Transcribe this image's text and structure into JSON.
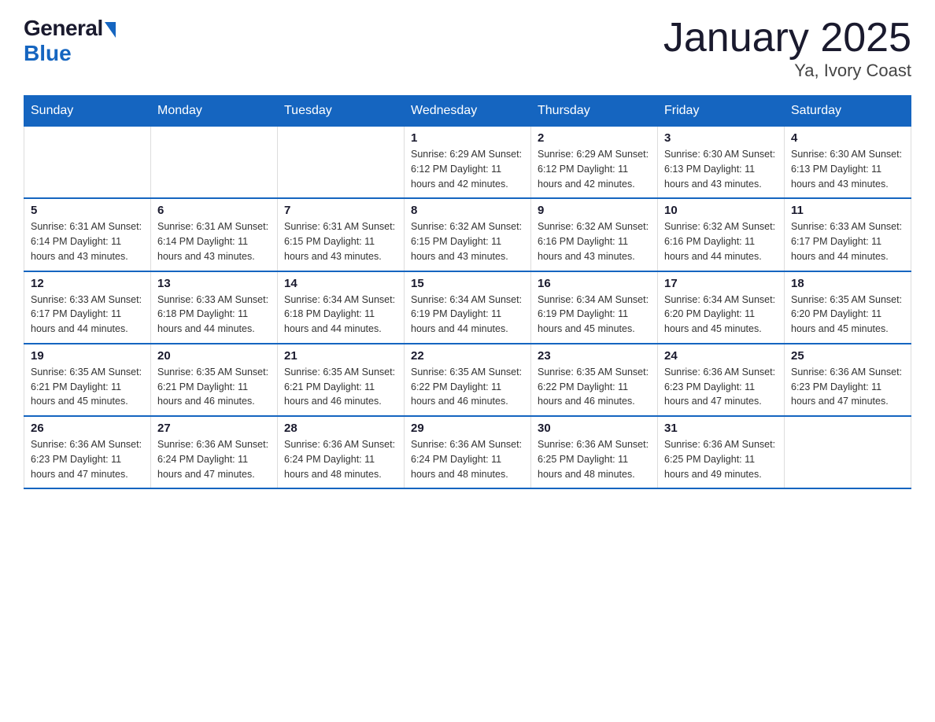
{
  "logo": {
    "general": "General",
    "blue": "Blue"
  },
  "title": "January 2025",
  "subtitle": "Ya, Ivory Coast",
  "days_of_week": [
    "Sunday",
    "Monday",
    "Tuesday",
    "Wednesday",
    "Thursday",
    "Friday",
    "Saturday"
  ],
  "weeks": [
    [
      {
        "num": "",
        "info": ""
      },
      {
        "num": "",
        "info": ""
      },
      {
        "num": "",
        "info": ""
      },
      {
        "num": "1",
        "info": "Sunrise: 6:29 AM\nSunset: 6:12 PM\nDaylight: 11 hours and 42 minutes."
      },
      {
        "num": "2",
        "info": "Sunrise: 6:29 AM\nSunset: 6:12 PM\nDaylight: 11 hours and 42 minutes."
      },
      {
        "num": "3",
        "info": "Sunrise: 6:30 AM\nSunset: 6:13 PM\nDaylight: 11 hours and 43 minutes."
      },
      {
        "num": "4",
        "info": "Sunrise: 6:30 AM\nSunset: 6:13 PM\nDaylight: 11 hours and 43 minutes."
      }
    ],
    [
      {
        "num": "5",
        "info": "Sunrise: 6:31 AM\nSunset: 6:14 PM\nDaylight: 11 hours and 43 minutes."
      },
      {
        "num": "6",
        "info": "Sunrise: 6:31 AM\nSunset: 6:14 PM\nDaylight: 11 hours and 43 minutes."
      },
      {
        "num": "7",
        "info": "Sunrise: 6:31 AM\nSunset: 6:15 PM\nDaylight: 11 hours and 43 minutes."
      },
      {
        "num": "8",
        "info": "Sunrise: 6:32 AM\nSunset: 6:15 PM\nDaylight: 11 hours and 43 minutes."
      },
      {
        "num": "9",
        "info": "Sunrise: 6:32 AM\nSunset: 6:16 PM\nDaylight: 11 hours and 43 minutes."
      },
      {
        "num": "10",
        "info": "Sunrise: 6:32 AM\nSunset: 6:16 PM\nDaylight: 11 hours and 44 minutes."
      },
      {
        "num": "11",
        "info": "Sunrise: 6:33 AM\nSunset: 6:17 PM\nDaylight: 11 hours and 44 minutes."
      }
    ],
    [
      {
        "num": "12",
        "info": "Sunrise: 6:33 AM\nSunset: 6:17 PM\nDaylight: 11 hours and 44 minutes."
      },
      {
        "num": "13",
        "info": "Sunrise: 6:33 AM\nSunset: 6:18 PM\nDaylight: 11 hours and 44 minutes."
      },
      {
        "num": "14",
        "info": "Sunrise: 6:34 AM\nSunset: 6:18 PM\nDaylight: 11 hours and 44 minutes."
      },
      {
        "num": "15",
        "info": "Sunrise: 6:34 AM\nSunset: 6:19 PM\nDaylight: 11 hours and 44 minutes."
      },
      {
        "num": "16",
        "info": "Sunrise: 6:34 AM\nSunset: 6:19 PM\nDaylight: 11 hours and 45 minutes."
      },
      {
        "num": "17",
        "info": "Sunrise: 6:34 AM\nSunset: 6:20 PM\nDaylight: 11 hours and 45 minutes."
      },
      {
        "num": "18",
        "info": "Sunrise: 6:35 AM\nSunset: 6:20 PM\nDaylight: 11 hours and 45 minutes."
      }
    ],
    [
      {
        "num": "19",
        "info": "Sunrise: 6:35 AM\nSunset: 6:21 PM\nDaylight: 11 hours and 45 minutes."
      },
      {
        "num": "20",
        "info": "Sunrise: 6:35 AM\nSunset: 6:21 PM\nDaylight: 11 hours and 46 minutes."
      },
      {
        "num": "21",
        "info": "Sunrise: 6:35 AM\nSunset: 6:21 PM\nDaylight: 11 hours and 46 minutes."
      },
      {
        "num": "22",
        "info": "Sunrise: 6:35 AM\nSunset: 6:22 PM\nDaylight: 11 hours and 46 minutes."
      },
      {
        "num": "23",
        "info": "Sunrise: 6:35 AM\nSunset: 6:22 PM\nDaylight: 11 hours and 46 minutes."
      },
      {
        "num": "24",
        "info": "Sunrise: 6:36 AM\nSunset: 6:23 PM\nDaylight: 11 hours and 47 minutes."
      },
      {
        "num": "25",
        "info": "Sunrise: 6:36 AM\nSunset: 6:23 PM\nDaylight: 11 hours and 47 minutes."
      }
    ],
    [
      {
        "num": "26",
        "info": "Sunrise: 6:36 AM\nSunset: 6:23 PM\nDaylight: 11 hours and 47 minutes."
      },
      {
        "num": "27",
        "info": "Sunrise: 6:36 AM\nSunset: 6:24 PM\nDaylight: 11 hours and 47 minutes."
      },
      {
        "num": "28",
        "info": "Sunrise: 6:36 AM\nSunset: 6:24 PM\nDaylight: 11 hours and 48 minutes."
      },
      {
        "num": "29",
        "info": "Sunrise: 6:36 AM\nSunset: 6:24 PM\nDaylight: 11 hours and 48 minutes."
      },
      {
        "num": "30",
        "info": "Sunrise: 6:36 AM\nSunset: 6:25 PM\nDaylight: 11 hours and 48 minutes."
      },
      {
        "num": "31",
        "info": "Sunrise: 6:36 AM\nSunset: 6:25 PM\nDaylight: 11 hours and 49 minutes."
      },
      {
        "num": "",
        "info": ""
      }
    ]
  ]
}
